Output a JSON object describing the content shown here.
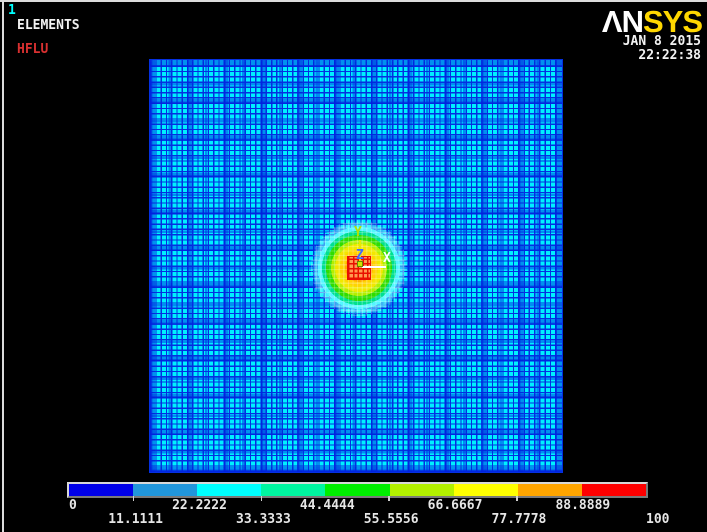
{
  "header": {
    "plot_number": "1",
    "plot_type": "ELEMENTS",
    "load_label": "HFLU",
    "date": "JAN  8 2015",
    "time": "22:22:38",
    "logo_an": "ΛN",
    "logo_sys": "SYS"
  },
  "triad": {
    "x": "X",
    "y": "Y",
    "z": "Z"
  },
  "colors": {
    "background": "#000000",
    "mesh_cell_cyan": "#00F0FF",
    "mesh_line_blue": "#0530E0",
    "plot_number_cyan": "#00FFFF",
    "annotation_red": "#D83030",
    "text_white": "#F2F2F2",
    "logo_white": "#FFFFFF",
    "logo_yellow": "#FFD700",
    "hotspot_peak_red": "#E81000"
  },
  "chart_data": {
    "type": "heatmap",
    "title": "ELEMENTS plot with HFLU (heat flux) contour legend",
    "legend_position": "bottom",
    "legend": {
      "min": 0,
      "max": 100,
      "tick_values": [
        0,
        11.1111,
        22.2222,
        33.3333,
        44.4444,
        55.5556,
        66.6667,
        77.7778,
        88.8889,
        100
      ],
      "tick_labels": [
        "0",
        "11.1111",
        "22.2222",
        "33.3333",
        "44.4444",
        "55.5556",
        "66.6667",
        "77.7778",
        "88.8889",
        "100"
      ],
      "segment_colors": [
        "#0000E8",
        "#2196DB",
        "#00FFFF",
        "#00F5A0",
        "#00EE00",
        "#B2F000",
        "#FFFF00",
        "#FFA500",
        "#FF0000"
      ],
      "tick_mark_boundaries": [
        1,
        3,
        5,
        7
      ]
    },
    "field": {
      "shape": "square plate, uniform graded mesh",
      "peak_location": "plate center",
      "peak_value": 100,
      "far_field_value": 0
    }
  }
}
